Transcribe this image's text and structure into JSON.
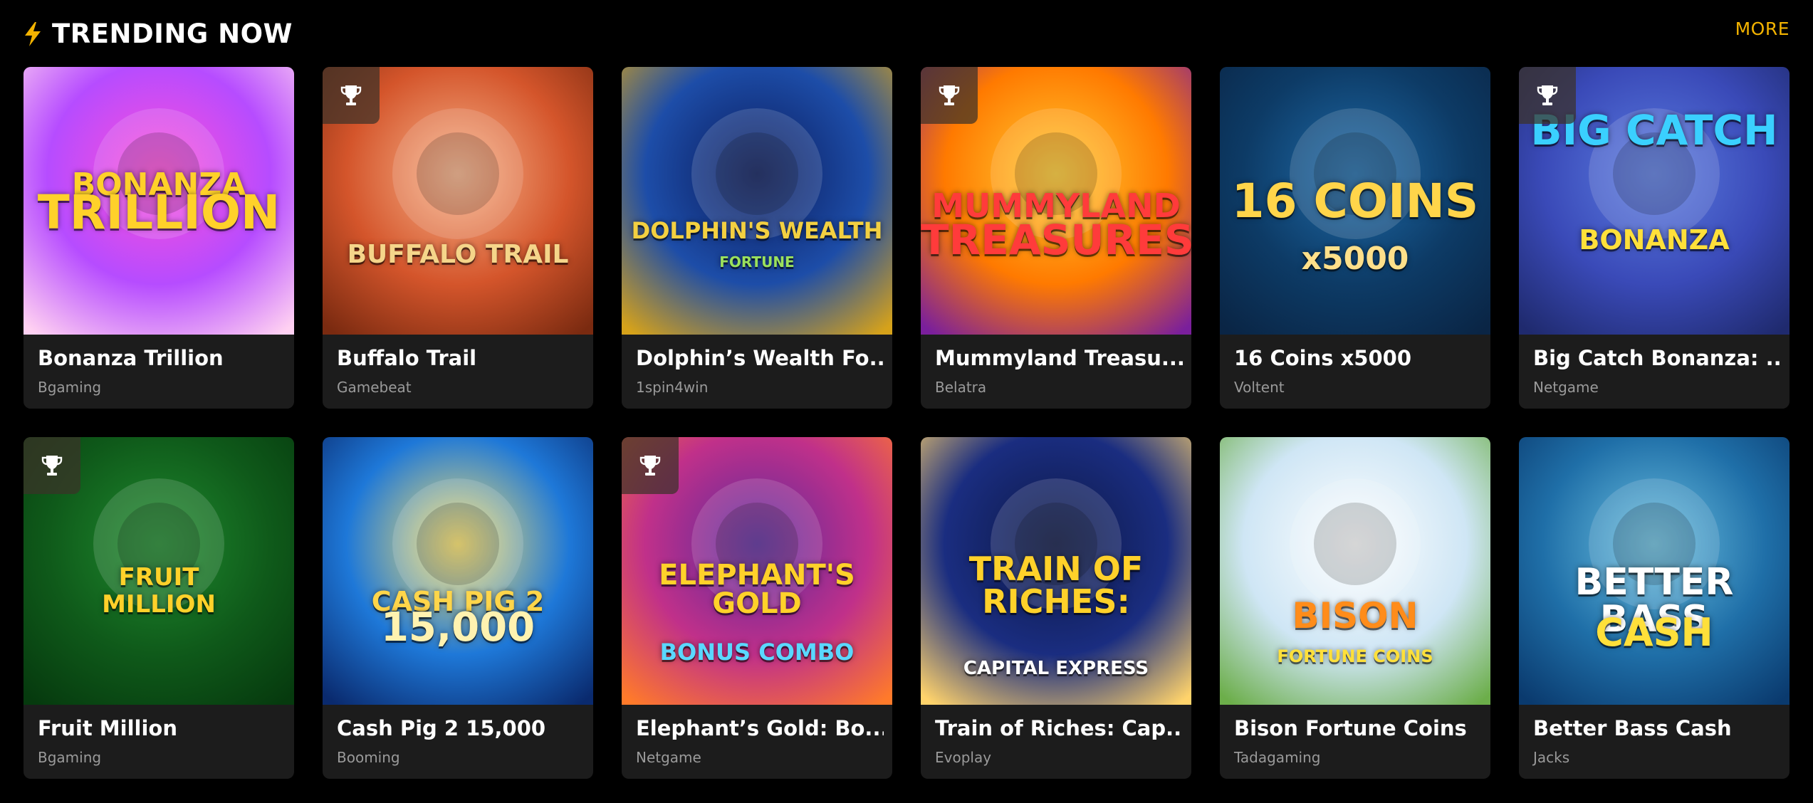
{
  "section": {
    "icon": "lightning-icon",
    "title": "TRENDING NOW",
    "more_label": "MORE",
    "accent": "#f3b300"
  },
  "games": [
    {
      "name": "Bonanza Trillion",
      "provider": "Bgaming",
      "trophy": false,
      "art_title": "BONANZA",
      "art_subtitle": "TRILLION"
    },
    {
      "name": "Buffalo Trail",
      "provider": "Gamebeat",
      "trophy": true,
      "art_title": "BUFFALO TRAIL",
      "art_subtitle": ""
    },
    {
      "name": "Dolphin’s Wealth Fo...",
      "provider": "1spin4win",
      "trophy": false,
      "art_title": "DOLPHIN'S WEALTH",
      "art_subtitle": "FORTUNE"
    },
    {
      "name": "Mummyland Treasu...",
      "provider": "Belatra",
      "trophy": true,
      "art_title": "MUMMYLAND",
      "art_subtitle": "TREASURES"
    },
    {
      "name": "16 Coins x5000",
      "provider": "Voltent",
      "trophy": false,
      "art_title": "16 COINS",
      "art_subtitle": "x5000"
    },
    {
      "name": "Big Catch Bonanza: ...",
      "provider": "Netgame",
      "trophy": true,
      "art_title": "BIG CATCH",
      "art_subtitle": "BONANZA"
    },
    {
      "name": "Fruit Million",
      "provider": "Bgaming",
      "trophy": true,
      "art_title": "FRUIT",
      "art_subtitle": "MILLION"
    },
    {
      "name": "Cash Pig 2 15,000",
      "provider": "Booming",
      "trophy": false,
      "art_title": "CASH PIG 2",
      "art_subtitle": "15,000"
    },
    {
      "name": "Elephant’s Gold: Bo...",
      "provider": "Netgame",
      "trophy": true,
      "art_title": "ELEPHANT'S GOLD",
      "art_subtitle": "BONUS COMBO"
    },
    {
      "name": "Train of Riches: Cap...",
      "provider": "Evoplay",
      "trophy": false,
      "art_title": "TRAIN OF RICHES:",
      "art_subtitle": "CAPITAL EXPRESS"
    },
    {
      "name": "Bison Fortune Coins",
      "provider": "Tadagaming",
      "trophy": false,
      "art_title": "BISON",
      "art_subtitle": "FORTUNE COINS"
    },
    {
      "name": "Better Bass Cash",
      "provider": "Jacks",
      "trophy": false,
      "art_title": "BETTER BASS",
      "art_subtitle": "CASH"
    }
  ]
}
